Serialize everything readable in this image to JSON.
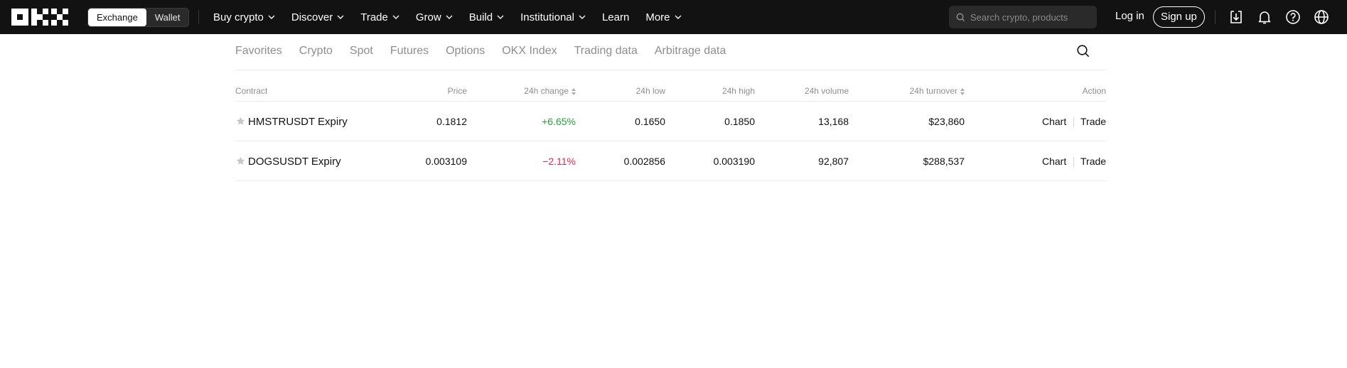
{
  "topbar": {
    "mode_switch": {
      "exchange": "Exchange",
      "wallet": "Wallet",
      "selected": "Exchange"
    },
    "nav": [
      {
        "label": "Buy crypto",
        "dropdown": true
      },
      {
        "label": "Discover",
        "dropdown": true
      },
      {
        "label": "Trade",
        "dropdown": true
      },
      {
        "label": "Grow",
        "dropdown": true
      },
      {
        "label": "Build",
        "dropdown": true
      },
      {
        "label": "Institutional",
        "dropdown": true
      },
      {
        "label": "Learn",
        "dropdown": false
      },
      {
        "label": "More",
        "dropdown": true
      }
    ],
    "search": {
      "placeholder": "Search crypto, products",
      "value": ""
    },
    "login": "Log in",
    "signup": "Sign up",
    "icons": [
      "download-icon",
      "bell-icon",
      "help-icon",
      "globe-icon"
    ]
  },
  "tabs": [
    "Favorites",
    "Crypto",
    "Spot",
    "Futures",
    "Options",
    "OKX Index",
    "Trading data",
    "Arbitrage data"
  ],
  "table": {
    "headers": {
      "contract": "Contract",
      "price": "Price",
      "change": "24h change",
      "low": "24h low",
      "high": "24h high",
      "volume": "24h volume",
      "turnover": "24h turnover",
      "action": "Action"
    },
    "rows": [
      {
        "contract": "HMSTRUSDT Expiry",
        "price": "0.1812",
        "change": "+6.65%",
        "direction": "up",
        "low": "0.1650",
        "high": "0.1850",
        "volume": "13,168",
        "turnover": "$23,860",
        "chart": "Chart",
        "trade": "Trade"
      },
      {
        "contract": "DOGSUSDT Expiry",
        "price": "0.003109",
        "change": "−2.11%",
        "direction": "down",
        "low": "0.002856",
        "high": "0.003190",
        "volume": "92,807",
        "turnover": "$288,537",
        "chart": "Chart",
        "trade": "Trade"
      }
    ]
  },
  "colors": {
    "topbar_bg": "#121212",
    "positive": "#26a13c",
    "negative": "#e0294a",
    "muted_text": "#8e8e8e"
  }
}
